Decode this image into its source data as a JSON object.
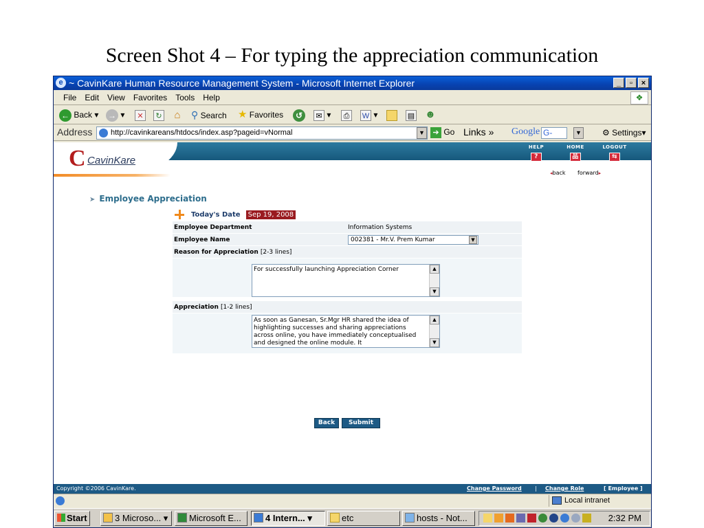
{
  "slide_title": "Screen Shot 4 – For typing the appreciation communication",
  "window": {
    "title": "~ CavinKare Human Resource Management System - Microsoft Internet Explorer",
    "buttons": [
      "_",
      "▫",
      "×"
    ]
  },
  "menu": [
    "File",
    "Edit",
    "View",
    "Favorites",
    "Tools",
    "Help"
  ],
  "toolbar": {
    "back": "Back",
    "search": "Search",
    "favorites": "Favorites"
  },
  "address": {
    "label": "Address",
    "url": "http://cavinkareans/htdocs/index.asp?pageid=vNormal",
    "go": "Go",
    "links": "Links",
    "google": "Google",
    "google_box": "G-",
    "settings": "Settings"
  },
  "app": {
    "logo_text": "CavinKare",
    "top_links": {
      "help": "HELP",
      "home": "HOME",
      "logout": "LOGOUT"
    },
    "nav": {
      "back": "back",
      "forward": "forward"
    },
    "section_title": "Employee Appreciation",
    "todays_date_label": "Today's Date",
    "todays_date": "Sep 19, 2008",
    "form": {
      "department_label": "Employee Department",
      "department_value": "Information Systems",
      "name_label": "Employee Name",
      "name_value": "002381 - Mr.V. Prem Kumar",
      "reason_label": "Reason for Appreciation",
      "reason_hint": "[2-3 lines]",
      "reason_text": "For successfully launching Appreciation Corner",
      "appreciation_label": "Appreciation",
      "appreciation_hint": "[1-2 lines]",
      "appreciation_text": "As soon as Ganesan, Sr.Mgr HR shared the idea of highlighting successes and sharing appreciations across online, you have immediately conceptualised and designed the online module. It"
    },
    "buttons": {
      "back": "Back",
      "submit": "Submit"
    },
    "footer": {
      "copyright": "Copyright ©2006 CavinKare.",
      "change_password": "Change Password",
      "separator": "|",
      "change_role": "Change Role",
      "role": "[ Employee ]"
    }
  },
  "statusbar": {
    "zone": "Local intranet"
  },
  "taskbar": {
    "start": "Start",
    "tasks": [
      "3 Microso...",
      "Microsoft E...",
      "4 Intern...",
      "etc",
      "hosts - Not..."
    ],
    "clock": "2:32 PM"
  },
  "colors": {
    "title_bar": "#0a4ab8",
    "header_band": "#1d5a85",
    "date_badge": "#9a1b20",
    "section_title": "#2d6d8c",
    "logo_red": "#b31d1d",
    "swoosh_orange": "#f28c28"
  }
}
